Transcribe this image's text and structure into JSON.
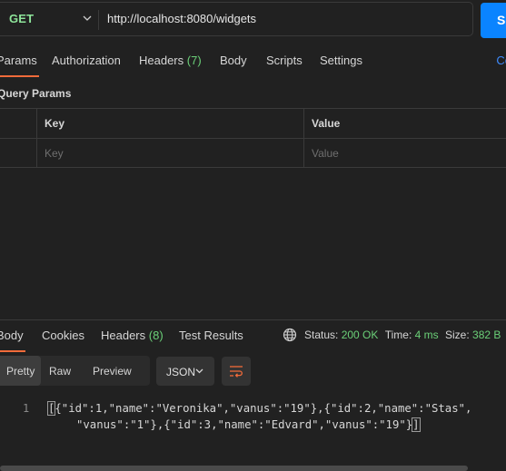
{
  "request": {
    "method": "GET",
    "url": "http://localhost:8080/widgets",
    "send_label": "Se"
  },
  "request_tabs": {
    "params": "Params",
    "authorization": "Authorization",
    "headers": "Headers",
    "headers_count": "(7)",
    "body": "Body",
    "scripts": "Scripts",
    "settings": "Settings",
    "cookies_link": "Co"
  },
  "query_params": {
    "title": "Query Params",
    "columns": [
      "Key",
      "Value"
    ],
    "placeholders": [
      "Key",
      "Value"
    ]
  },
  "response_tabs": {
    "body": "Body",
    "cookies": "Cookies",
    "headers": "Headers",
    "headers_count": "(8)",
    "test_results": "Test Results"
  },
  "status": {
    "status_label": "Status:",
    "status_value": "200 OK",
    "time_label": "Time:",
    "time_value": "4 ms",
    "size_label": "Size:",
    "size_value": "382 B"
  },
  "view_modes": [
    "Pretty",
    "Raw",
    "Preview"
  ],
  "format_select": "JSON",
  "code": {
    "line_number": "1",
    "line1": "{\"id\":1,\"name\":\"Veronika\",\"vanus\":\"19\"},{\"id\":2,\"name\":\"Stas\",",
    "line2": "\"vanus\":\"1\"},{\"id\":3,\"name\":\"Edvard\",\"vanus\":\"19\"}",
    "open_bracket": "[",
    "close_bracket": "]"
  },
  "colors": {
    "method": "#8ee59a",
    "accent": "#f26b3a",
    "send": "#0a84ff",
    "ok": "#6bd078"
  }
}
